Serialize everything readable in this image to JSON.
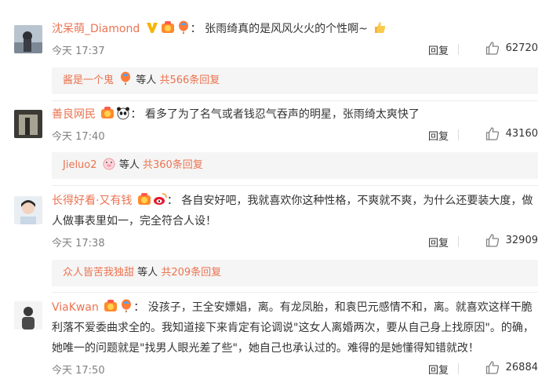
{
  "comments": [
    {
      "username": "沈呆萌_Diamond",
      "text": "张雨绮真的是风风火火的个性啊~",
      "time": "今天 17:37",
      "reply_label": "回复",
      "likes": "62720",
      "sub": {
        "user": "酱是一个鬼",
        "mid": "等人",
        "count": "共566条回复"
      }
    },
    {
      "username": "善良网民",
      "text": "看多了为了名气或者钱忍气吞声的明星，张雨绮太爽快了",
      "time": "今天 17:40",
      "reply_label": "回复",
      "likes": "43160",
      "sub": {
        "user": "Jieluo2",
        "mid": "等人",
        "count": "共360条回复"
      }
    },
    {
      "username": "长得好看·又有钱",
      "text": "各自安好吧，我就喜欢你这种性格，不爽就不爽，为什么还要装大度，做人做事表里如一，完全符合人设！",
      "time": "今天 17:38",
      "reply_label": "回复",
      "likes": "32909",
      "sub": {
        "user": "众人皆苦我独甜",
        "mid": "等人",
        "count": "共209条回复"
      }
    },
    {
      "username": "ViaKwan",
      "text": "没孩子，王全安嫖娼，离。有龙凤胎，和袁巴元感情不和，离。就喜欢这样干脆利落不爱委曲求全的。我知道接下来肯定有论调说\"这女人离婚两次，要从自己身上找原因\"。的确，她唯一的问题就是\"找男人眼光差了些\"，她自己也承认过的。难得的是她懂得知错就改！",
      "time": "今天 17:50",
      "reply_label": "回复",
      "likes": "26884"
    }
  ],
  "colors": {
    "username": "#eb7350",
    "text": "#333333",
    "meta": "#808080",
    "sub_bg": "#f5f5f5"
  },
  "icons": [
    "avatar",
    "vip-v-icon",
    "badge-icon",
    "balloon-icon",
    "panda-icon",
    "pig-icon",
    "weibo-icon",
    "thumbs-up-emoji-icon",
    "like-thumb-icon"
  ]
}
